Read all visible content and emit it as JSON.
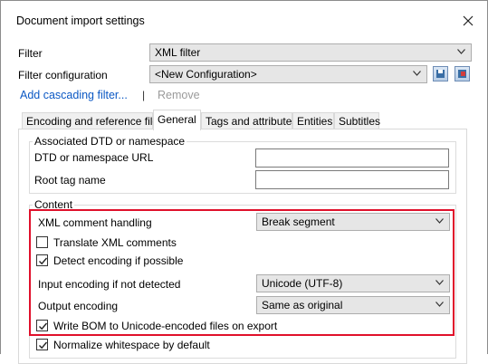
{
  "window": {
    "title": "Document import settings"
  },
  "filter": {
    "label": "Filter",
    "value": "XML filter"
  },
  "filter_config": {
    "label": "Filter configuration",
    "value": "<New Configuration>"
  },
  "links": {
    "add_cascading": "Add cascading filter...",
    "separator": "|",
    "remove": "Remove"
  },
  "tabs": [
    {
      "label": "Encoding and reference files"
    },
    {
      "label": "General"
    },
    {
      "label": "Tags and attributes"
    },
    {
      "label": "Entities"
    },
    {
      "label": "Subtitles"
    }
  ],
  "dtd_group": {
    "legend": "Associated DTD or namespace",
    "dtd_label": "DTD or namespace URL",
    "dtd_value": "",
    "root_label": "Root tag name",
    "root_value": ""
  },
  "content_group": {
    "legend": "Content",
    "comment_handling_label": "XML comment handling",
    "comment_handling_value": "Break segment",
    "translate_comments_label": "Translate XML comments",
    "translate_comments_checked": false,
    "detect_encoding_label": "Detect encoding if possible",
    "detect_encoding_checked": true,
    "input_encoding_label": "Input encoding if not detected",
    "input_encoding_value": "Unicode (UTF-8)",
    "output_encoding_label": "Output encoding",
    "output_encoding_value": "Same as original",
    "write_bom_label": "Write BOM to Unicode-encoded files on export",
    "write_bom_checked": true,
    "normalize_ws_label": "Normalize whitespace by default",
    "normalize_ws_checked": true
  },
  "colors": {
    "link": "#0b58c4",
    "highlight_border": "#e0102b",
    "disabled_text": "#9a9a9a"
  },
  "icons": [
    "close-icon",
    "chevron-down-icon",
    "save-config-icon",
    "delete-config-icon",
    "checkmark-icon"
  ]
}
